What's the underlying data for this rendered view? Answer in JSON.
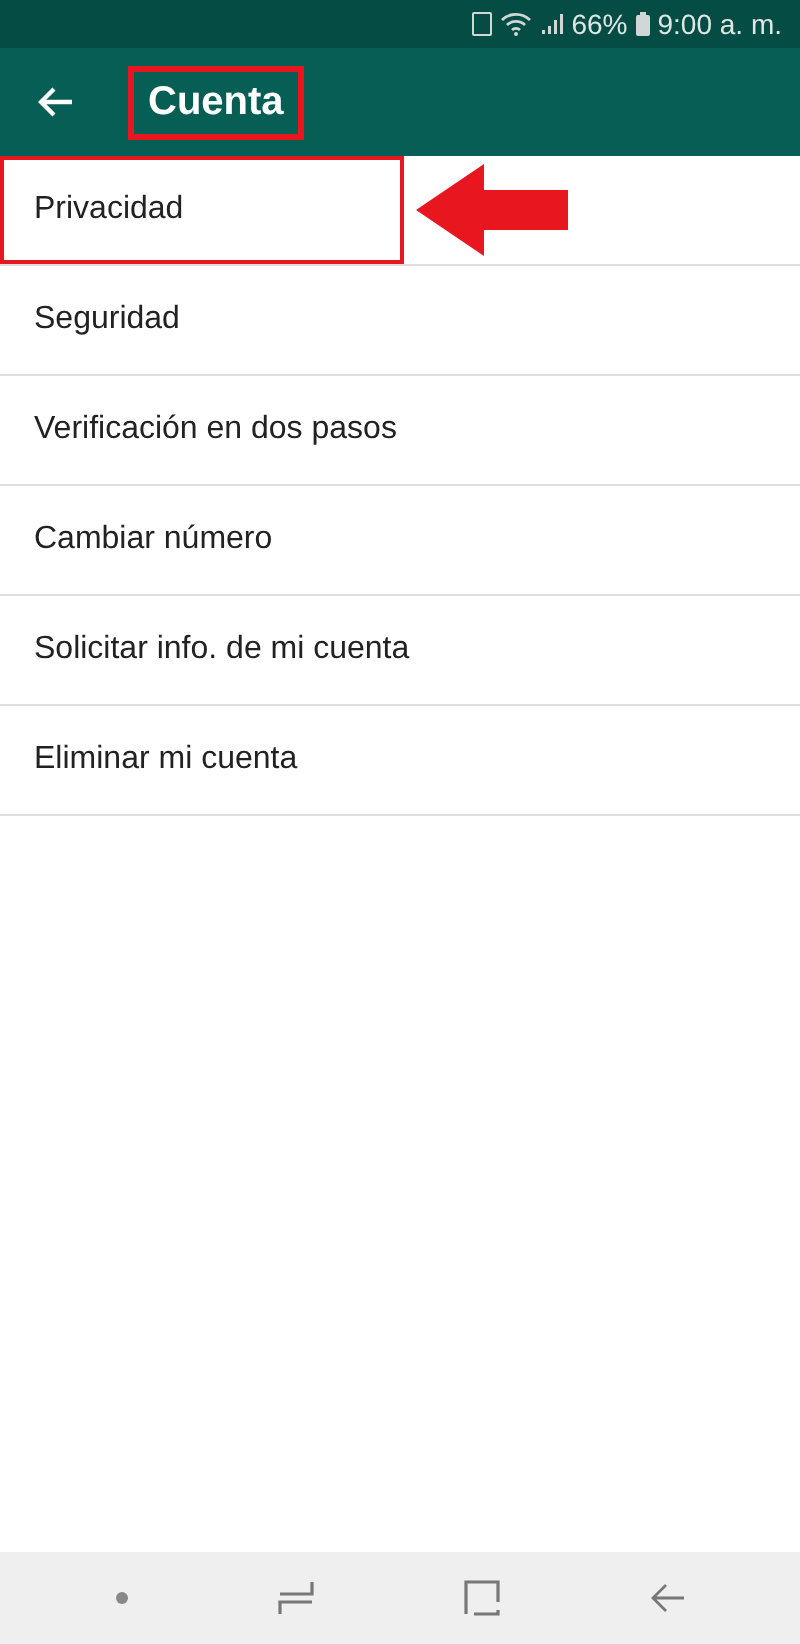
{
  "status_bar": {
    "battery": "66%",
    "time": "9:00 a. m."
  },
  "app_bar": {
    "title": "Cuenta",
    "title_highlighted": true
  },
  "menu_items": [
    {
      "label": "Privacidad",
      "highlighted": true
    },
    {
      "label": "Seguridad",
      "highlighted": false
    },
    {
      "label": "Verificación en dos pasos",
      "highlighted": false
    },
    {
      "label": "Cambiar número",
      "highlighted": false
    },
    {
      "label": "Solicitar info. de mi cuenta",
      "highlighted": false
    },
    {
      "label": "Eliminar mi cuenta",
      "highlighted": false
    }
  ]
}
